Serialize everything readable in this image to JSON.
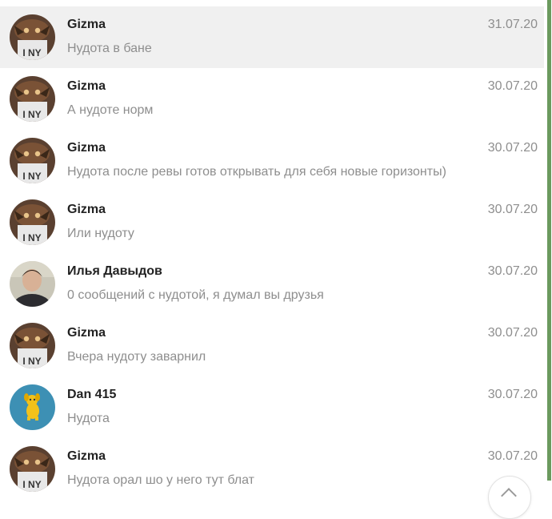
{
  "dialogs": [
    {
      "name": "Gizma",
      "message": "Нудота в бане",
      "date": "31.07.20",
      "avatar": "gizma-avatar",
      "active": true
    },
    {
      "name": "Gizma",
      "message": "А нудоте норм",
      "date": "30.07.20",
      "avatar": "gizma-avatar"
    },
    {
      "name": "Gizma",
      "message": "Нудота после ревы готов открывать для себя новые горизонты)",
      "date": "30.07.20",
      "avatar": "gizma-avatar"
    },
    {
      "name": "Gizma",
      "message": "Или нудоту",
      "date": "30.07.20",
      "avatar": "gizma-avatar"
    },
    {
      "name": "Илья Давыдов",
      "message": "0 сообщений с нудотой, я думал вы друзья",
      "date": "30.07.20",
      "avatar": "ilya-avatar"
    },
    {
      "name": "Gizma",
      "message": "Вчера нудоту заварнил",
      "date": "30.07.20",
      "avatar": "gizma-avatar"
    },
    {
      "name": "Dan 415",
      "message": "Нудота",
      "date": "30.07.20",
      "avatar": "dan-avatar"
    },
    {
      "name": "Gizma",
      "message": "Нудота орал шо у него тут блат",
      "date": "30.07.20",
      "avatar": "gizma-avatar"
    }
  ],
  "scroll_up_icon": "chevron-up-icon",
  "colors": {
    "active_row": "#f0f0f0",
    "muted_text": "#8e8e8e",
    "scrollbar": "#6b9a5e",
    "dan_avatar_bg": "#3d90b4"
  }
}
